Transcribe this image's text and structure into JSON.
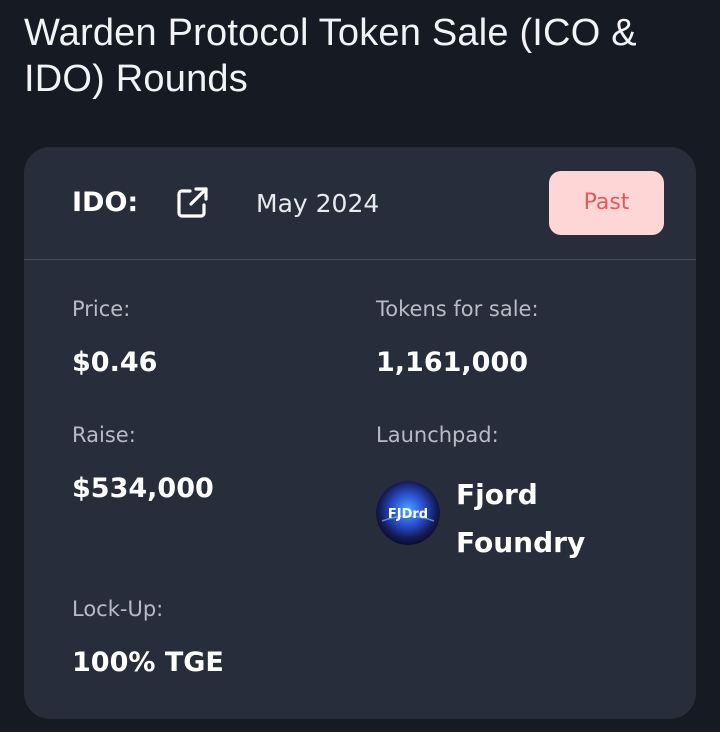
{
  "page": {
    "title": "Warden Protocol Token Sale (ICO & IDO) Rounds"
  },
  "round": {
    "type_label": "IDO:",
    "date": "May 2024",
    "status": "Past",
    "link_icon": "external-link-icon",
    "fields": {
      "price": {
        "label": "Price:",
        "value": "$0.46"
      },
      "tokens_for_sale": {
        "label": "Tokens for sale:",
        "value": "1,161,000"
      },
      "raise": {
        "label": "Raise:",
        "value": "$534,000"
      },
      "launchpad": {
        "label": "Launchpad:",
        "value": "Fjord Foundry",
        "logo_text": "FJDrd"
      },
      "lockup": {
        "label": "Lock-Up:",
        "value": "100% TGE"
      }
    }
  },
  "colors": {
    "background": "#161a22",
    "card": "#282d3b",
    "badge_bg": "#ffd6d6",
    "badge_text": "#e05a5a"
  }
}
